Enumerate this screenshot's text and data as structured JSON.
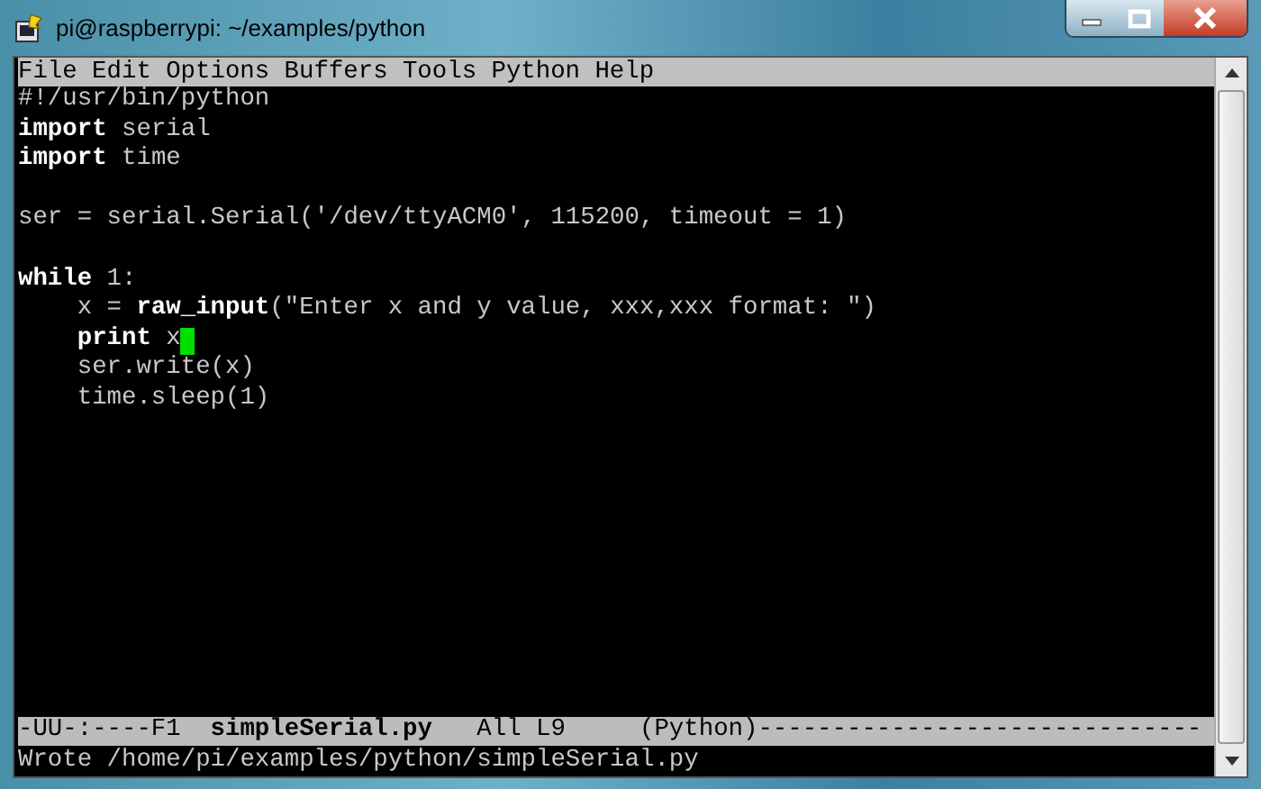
{
  "window": {
    "title": "pi@raspberrypi: ~/examples/python"
  },
  "menu": [
    "File",
    "Edit",
    "Options",
    "Buffers",
    "Tools",
    "Python",
    "Help"
  ],
  "lines": [
    {
      "text": "#!/usr/bin/python",
      "cursor": false
    },
    {
      "text": "**import** serial",
      "cursor": false
    },
    {
      "text": "**import** time",
      "cursor": false
    },
    {
      "cursor": false
    },
    {
      "text": "ser = serial.Serial('/dev/ttyACM0', 115200, timeout = 1)",
      "cursor": false
    },
    {
      "cursor": false
    },
    {
      "text": "**while** 1:",
      "cursor": false
    },
    {
      "text": "    x = **raw_input**(\"Enter x and y value, xxx,xxx format: \")",
      "cursor": false
    },
    {
      "text": "    **print** x",
      "cursor": true
    },
    {
      "text": "    ser.write(x)",
      "cursor": false
    },
    {
      "text": "    time.sleep(1)",
      "cursor": false
    }
  ],
  "mode_line": "-UU-:----F1  **simpleSerial.py**   All L9     (Python)------------------------------",
  "echo_area": "Wrote /home/pi/examples/python/simpleSerial.py"
}
